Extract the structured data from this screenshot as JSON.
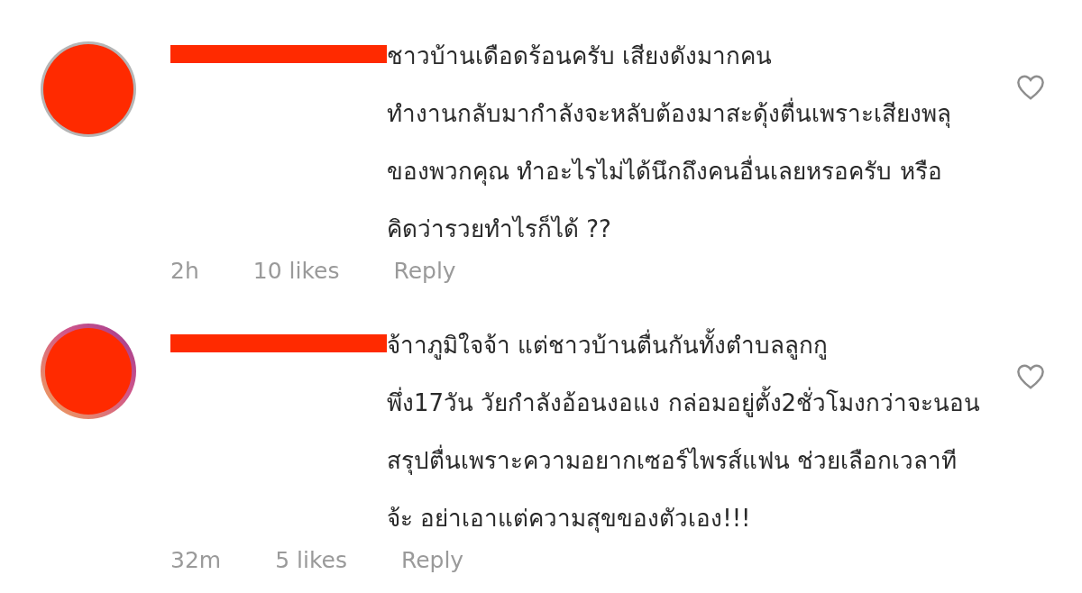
{
  "comments": [
    {
      "avatar": {
        "story_ring": false
      },
      "text": "ชาวบ้านเดือดร้อนครับ เสียงดังมากคน\nทำงานกลับมากำลังจะหลับต้องมาสะดุ้งตื่นเพราะเสียงพลุ\nของพวกคุณ ทำอะไรไม่ได้นึกถึงคนอื่นเลยหรอครับ หรือ\nคิดว่ารวยทำไรก็ได้ ??",
      "time": "2h",
      "likes": "10 likes",
      "reply": "Reply",
      "liked": false
    },
    {
      "avatar": {
        "story_ring": true
      },
      "text": "จ้าาภูมิใจจ้า แต่ชาวบ้านตื่นกันทั้งตำบลลูกกู\nพึ่ง17วัน วัยกำลังอ้อนงอแง กล่อมอยู่ตั้ง2ชั่วโมงกว่าจะนอน\nสรุปตื่นเพราะความอยากเซอร์ไพรส์แฟน ช่วยเลือกเวลาที\nจ้ะ อย่าเอาแต่ความสุขของตัวเอง!!!",
      "time": "32m",
      "likes": "5 likes",
      "reply": "Reply",
      "liked": false
    }
  ]
}
